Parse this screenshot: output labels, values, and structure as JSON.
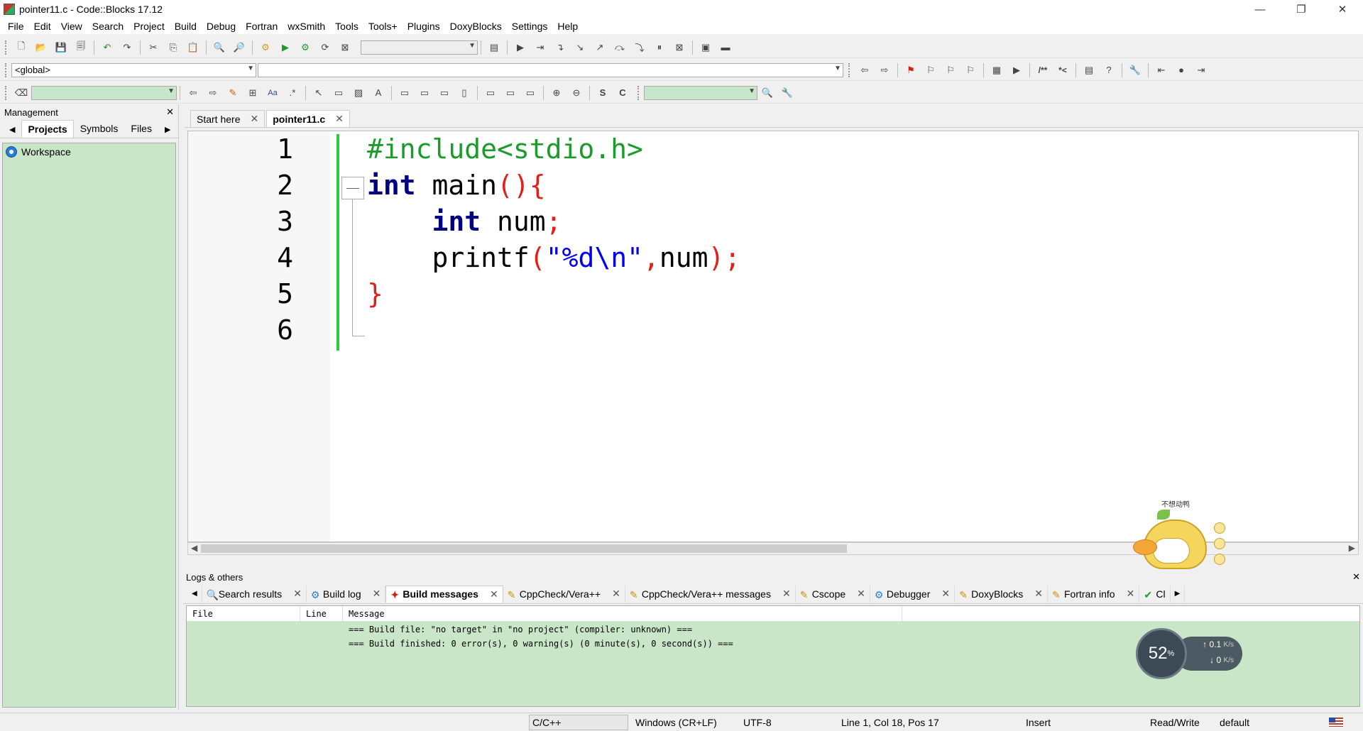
{
  "window": {
    "title": "pointer11.c - Code::Blocks 17.12",
    "minimize": "—",
    "restore": "❐",
    "close": "✕"
  },
  "menu": [
    "File",
    "Edit",
    "View",
    "Search",
    "Project",
    "Build",
    "Debug",
    "Fortran",
    "wxSmith",
    "Tools",
    "Tools+",
    "Plugins",
    "DoxyBlocks",
    "Settings",
    "Help"
  ],
  "toolbar": {
    "scope_combo": "<global>",
    "comment_block": "/**",
    "comment_line": "*<"
  },
  "management": {
    "title": "Management",
    "close": "✕",
    "tabs": [
      "Projects",
      "Symbols",
      "Files"
    ],
    "workspace": "Workspace"
  },
  "editor": {
    "tabs": [
      {
        "label": "Start here"
      },
      {
        "label": "pointer11.c"
      }
    ],
    "line_numbers": [
      "1",
      "2",
      "3",
      "4",
      "5",
      "6"
    ],
    "code": {
      "l1": "#include<stdio.h>",
      "l2_kw": "int",
      "l2_rest": " main",
      "l2_op": "(){",
      "l3_indent": "    ",
      "l3_kw": "int",
      "l3_rest": " num",
      "l3_op": ";",
      "l4_indent": "    ",
      "l4_fn": "printf",
      "l4_op1": "(",
      "l4_str": "\"%d\\n\"",
      "l4_comma": ",",
      "l4_arg": "num",
      "l4_op2": ");",
      "l5_op": "}"
    }
  },
  "logs": {
    "title": "Logs & others",
    "close": "✕",
    "tabs": [
      "Search results",
      "Build log",
      "Build messages",
      "CppCheck/Vera++",
      "CppCheck/Vera++ messages",
      "Cscope",
      "Debugger",
      "DoxyBlocks",
      "Fortran info",
      "Cl"
    ],
    "columns": [
      "File",
      "Line",
      "Message"
    ],
    "rows": [
      "=== Build file: \"no target\" in \"no project\" (compiler: unknown) ===",
      "=== Build finished: 0 error(s), 0 warning(s) (0 minute(s), 0 second(s)) ==="
    ]
  },
  "net_widget": {
    "percent": "52",
    "percent_unit": "%",
    "up": "0.1",
    "down": "0",
    "unit": "K/s"
  },
  "mascot": {
    "text": "不想动鸭"
  },
  "status": {
    "language": "C/C++",
    "eol": "Windows (CR+LF)",
    "encoding": "UTF-8",
    "position": "Line 1, Col 18, Pos 17",
    "mode": "Insert",
    "access": "Read/Write",
    "profile": "default"
  }
}
